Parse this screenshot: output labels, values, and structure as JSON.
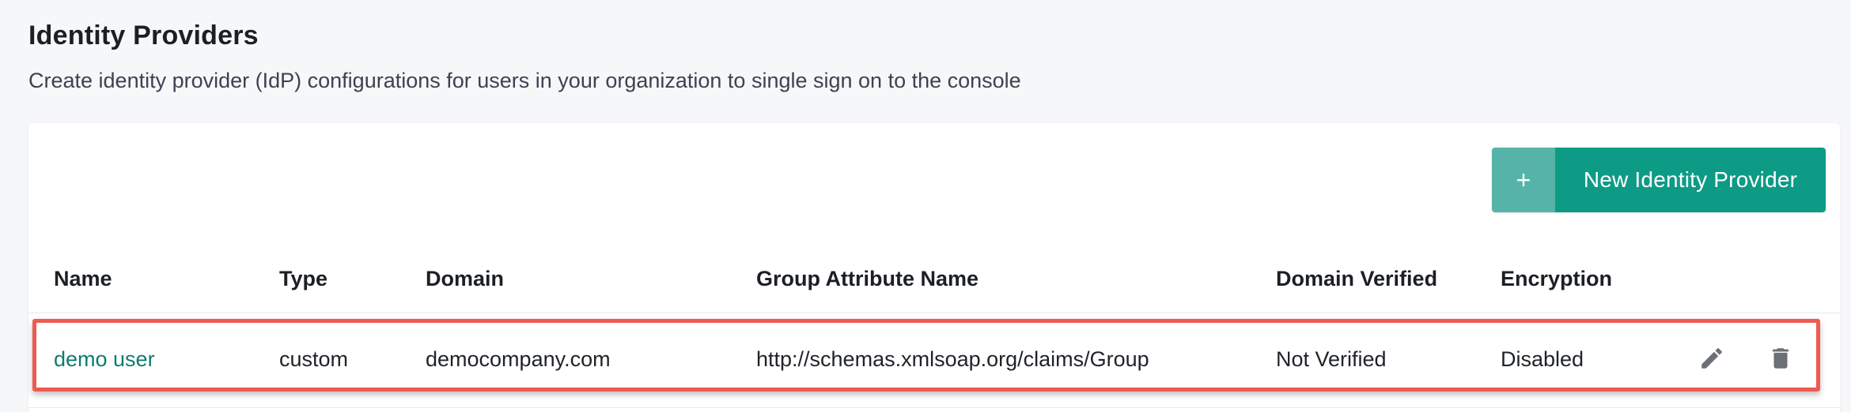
{
  "header": {
    "title": "Identity Providers",
    "subtitle": "Create identity provider (IdP) configurations for users in your organization to single sign on to the console"
  },
  "toolbar": {
    "new_button_icon": "+",
    "new_button_label": "New Identity Provider"
  },
  "table": {
    "columns": [
      "Name",
      "Type",
      "Domain",
      "Group Attribute Name",
      "Domain Verified",
      "Encryption"
    ],
    "rows": [
      {
        "name": "demo user",
        "type": "custom",
        "domain": "democompany.com",
        "group_attribute_name": "http://schemas.xmlsoap.org/claims/Group",
        "domain_verified": "Not Verified",
        "encryption": "Disabled",
        "actions": [
          "pencil-icon",
          "trash-icon"
        ]
      }
    ]
  },
  "colors": {
    "accent": "#0e9b86",
    "accent_light": "#55b4a7",
    "link": "#0e7d6d",
    "highlight": "#ee5a50",
    "icon": "#6b6f76"
  }
}
